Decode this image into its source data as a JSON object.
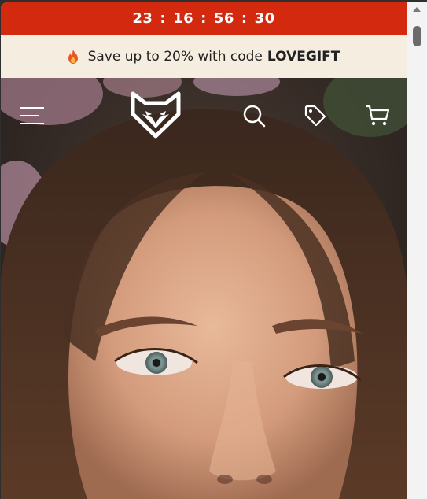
{
  "countdown": {
    "hours": "23",
    "minutes": "16",
    "seconds": "56",
    "centiseconds": "30",
    "separator": ":"
  },
  "promo": {
    "icon": "fire-icon",
    "text": "Save up to 20% with code",
    "code": "LOVEGIFT"
  },
  "header": {
    "icons": [
      "menu-icon",
      "fox-logo-icon",
      "search-icon",
      "tag-icon",
      "cart-icon"
    ]
  },
  "colors": {
    "countdown_bg": "#d2290f",
    "promo_bg": "#f5ede0",
    "header_icons": "#ffffff"
  }
}
